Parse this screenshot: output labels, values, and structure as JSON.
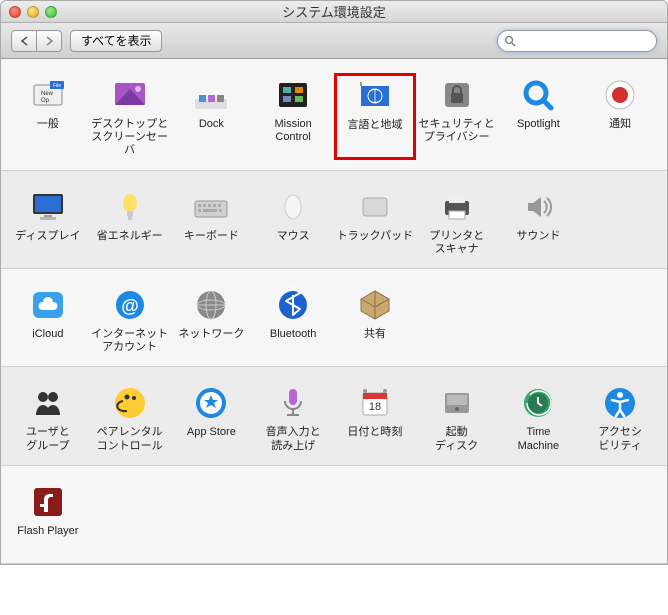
{
  "window": {
    "title": "システム環境設定"
  },
  "toolbar": {
    "show_all": "すべてを表示",
    "search_placeholder": ""
  },
  "rows": [
    [
      {
        "id": "general",
        "label": "一般"
      },
      {
        "id": "desktop",
        "label": "デスクトップと\nスクリーンセーバ"
      },
      {
        "id": "dock",
        "label": "Dock"
      },
      {
        "id": "mission",
        "label": "Mission\nControl"
      },
      {
        "id": "language",
        "label": "言語と地域",
        "highlight": true
      },
      {
        "id": "security",
        "label": "セキュリティと\nプライバシー"
      },
      {
        "id": "spotlight",
        "label": "Spotlight"
      },
      {
        "id": "notifications",
        "label": "通知"
      }
    ],
    [
      {
        "id": "displays",
        "label": "ディスプレイ"
      },
      {
        "id": "energy",
        "label": "省エネルギー"
      },
      {
        "id": "keyboard",
        "label": "キーボード"
      },
      {
        "id": "mouse",
        "label": "マウス"
      },
      {
        "id": "trackpad",
        "label": "トラックパッド"
      },
      {
        "id": "printers",
        "label": "プリンタと\nスキャナ"
      },
      {
        "id": "sound",
        "label": "サウンド"
      }
    ],
    [
      {
        "id": "icloud",
        "label": "iCloud"
      },
      {
        "id": "internet",
        "label": "インターネット\nアカウント"
      },
      {
        "id": "network",
        "label": "ネットワーク"
      },
      {
        "id": "bluetooth",
        "label": "Bluetooth"
      },
      {
        "id": "sharing",
        "label": "共有"
      }
    ],
    [
      {
        "id": "users",
        "label": "ユーザと\nグループ"
      },
      {
        "id": "parental",
        "label": "ペアレンタル\nコントロール"
      },
      {
        "id": "appstore",
        "label": "App Store"
      },
      {
        "id": "dictation",
        "label": "音声入力と\n読み上げ"
      },
      {
        "id": "datetime",
        "label": "日付と時刻"
      },
      {
        "id": "startup",
        "label": "起動\nディスク"
      },
      {
        "id": "timemachine",
        "label": "Time\nMachine"
      },
      {
        "id": "accessibility",
        "label": "アクセシ\nビリティ"
      }
    ],
    [
      {
        "id": "flash",
        "label": "Flash Player"
      }
    ]
  ]
}
